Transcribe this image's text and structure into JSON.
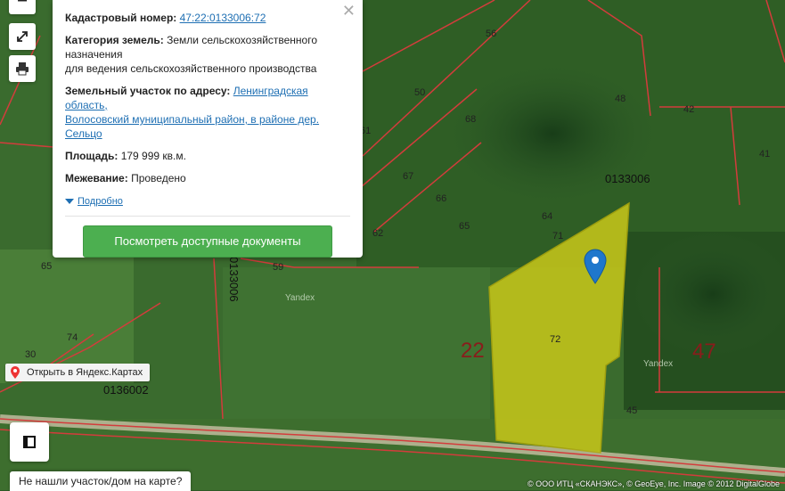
{
  "popup": {
    "cadastral_label": "Кадастровый номер:",
    "cadastral_value": "47:22:0133006:72",
    "category_label": "Категория земель:",
    "category_value_1": "Земли сельскохозяйственного",
    "category_value_2": "назначения",
    "category_value_3": "для ведения сельскохозяйственного производства",
    "address_label": "Земельный участок по адресу:",
    "address_value_1": "Ленинградская область,",
    "address_value_2": "Волосовский муниципальный район, в районе дер.",
    "address_value_3": "Сельцо",
    "area_label": "Площадь:",
    "area_value": "179 999 кв.м.",
    "survey_label": "Межевание:",
    "survey_value": "Проведено",
    "more_label": "Подробно",
    "close_glyph": "✕",
    "button_label": "Посмотреть доступные документы"
  },
  "map": {
    "yandex_link": "Открыть в Яндекс.Картах",
    "help_text": "Не нашли участок/дом на карте?",
    "copyright": "© ООО ИТЦ «СКАНЭКС», © GeoEye, Inc. Image © 2012 DigitalGlobe",
    "watermark_1": "Yandex",
    "watermark_2": "Yandex",
    "parcels": [
      "56",
      "50",
      "48",
      "42",
      "41",
      "68",
      "61",
      "67",
      "66",
      "65",
      "64",
      "62",
      "71",
      "59",
      "65",
      "74",
      "30",
      "72",
      "45"
    ],
    "quarter_1": "0133006",
    "quarter_2": "0136002",
    "quarter_3": "0133006",
    "big_num_1": "22",
    "big_num_2": "47",
    "minus_glyph": "−"
  },
  "colors": {
    "accent_button": "#4caf50",
    "selected_parcel": "#c9c81a",
    "boundary": "#d33c3c"
  }
}
